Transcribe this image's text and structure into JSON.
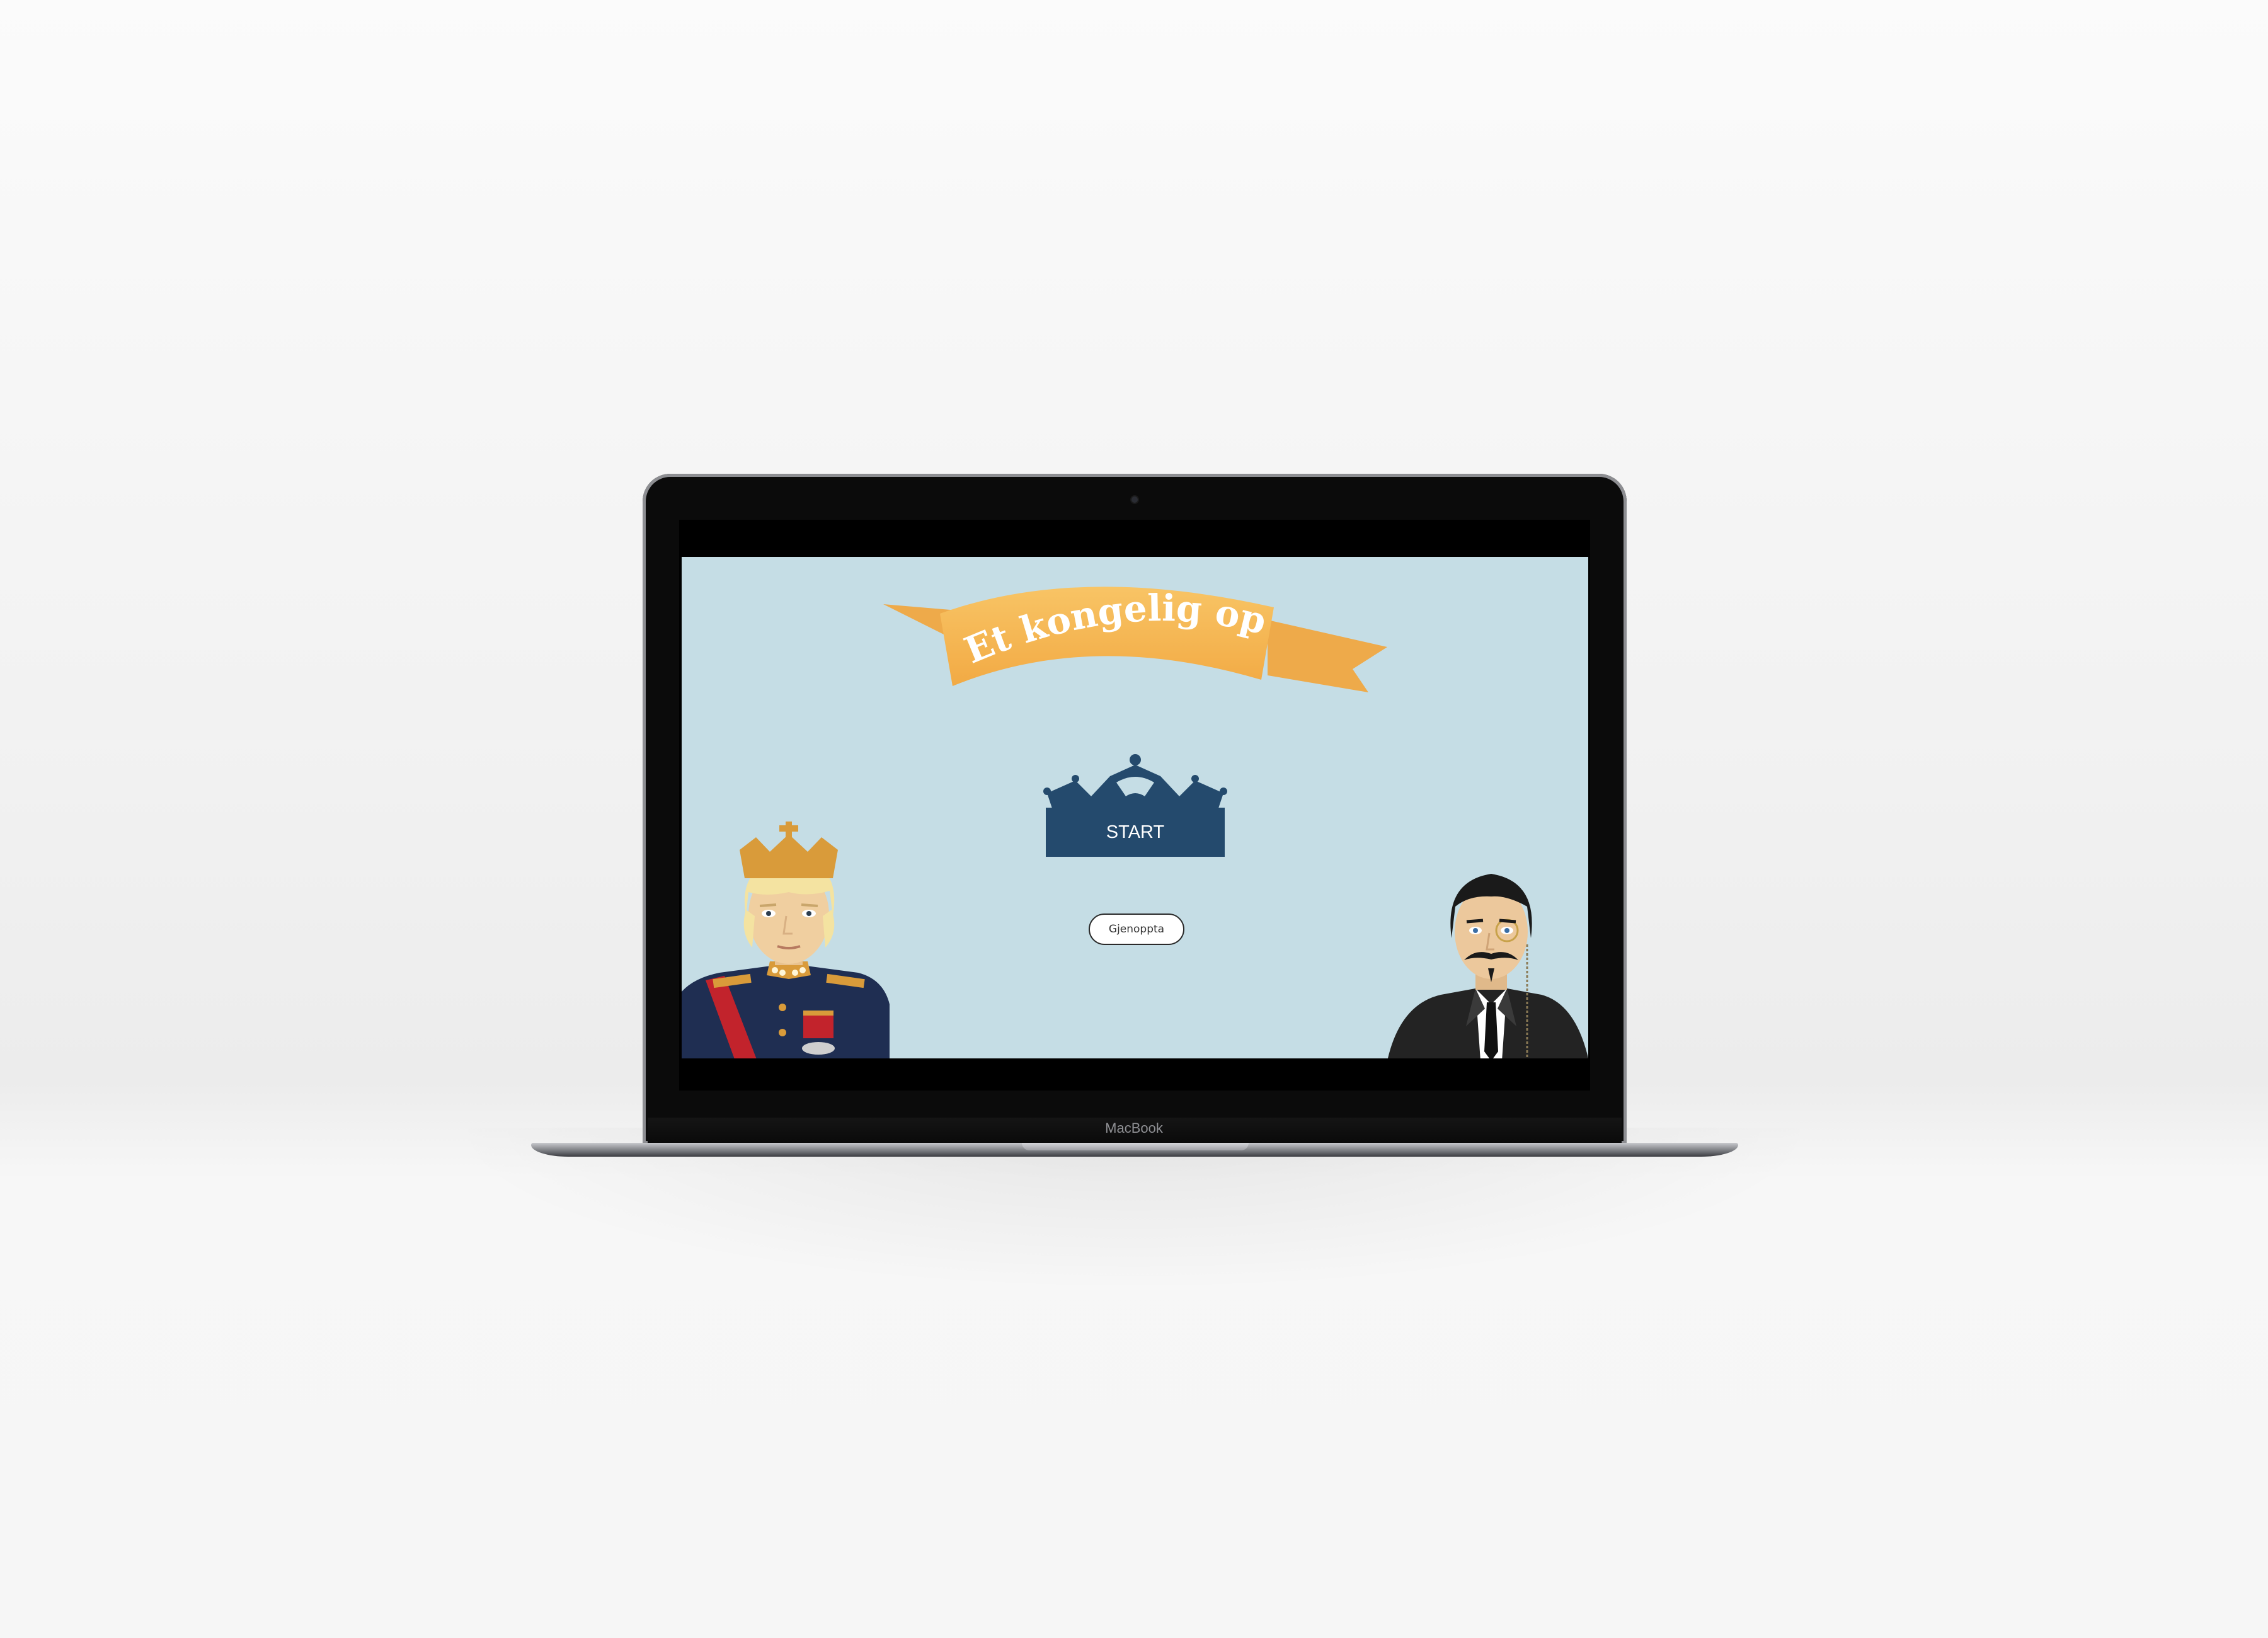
{
  "device": {
    "model_label": "MacBook"
  },
  "game": {
    "title": "Et kongelig oppdrag",
    "start_label": "START",
    "resume_label": "Gjenoppta"
  },
  "colors": {
    "screen_background": "#c5dde5",
    "banner": "#f5b754",
    "crown_button": "#244a6d",
    "king_crown": "#d99b3a",
    "king_uniform": "#1f2e52",
    "sash": "#c2232c",
    "suit": "#232323"
  },
  "characters": {
    "left": "king-icon",
    "right": "gentleman-with-monocle-icon"
  }
}
